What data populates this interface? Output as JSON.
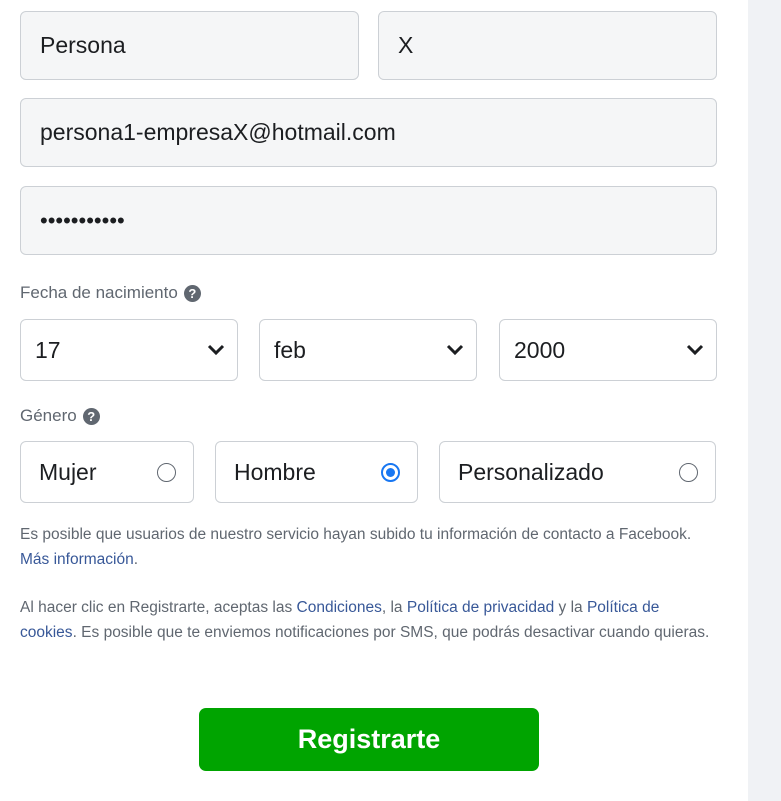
{
  "form": {
    "first_name": "Persona",
    "last_name": "X",
    "email": "persona1-empresaX@hotmail.com",
    "password_mask": "•••••••••••",
    "birthdate_label": "Fecha de nacimiento",
    "birth_day": "17",
    "birth_month": "feb",
    "birth_year": "2000",
    "gender_label": "Género",
    "gender_options": [
      {
        "label": "Mujer",
        "checked": false
      },
      {
        "label": "Hombre",
        "checked": true
      },
      {
        "label": "Personalizado",
        "checked": false
      }
    ],
    "info_text_1": "Es posible que usuarios de nuestro servicio hayan subido tu información de contacto a Facebook.",
    "info_link_1": "Más información",
    "terms_prefix": "Al hacer clic en Registrarte, aceptas las",
    "terms_link_conditions": "Condiciones",
    "terms_mid1": ", la",
    "terms_link_privacy": "Política de privacidad",
    "terms_mid2": "y la",
    "terms_link_cookies": "Política de cookies",
    "terms_suffix": ". Es posible que te enviemos notificaciones por SMS, que podrás desactivar cuando quieras.",
    "register_label": "Registrarte"
  },
  "colors": {
    "accent": "#1877f2",
    "button": "#00a400",
    "link": "#385898",
    "secondary_text": "#606770"
  }
}
